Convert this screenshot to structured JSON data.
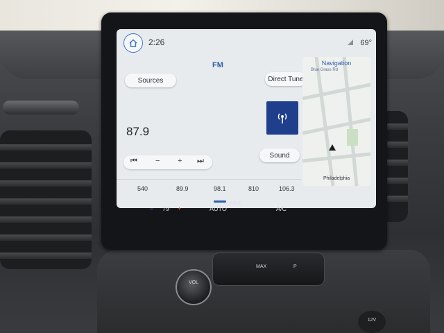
{
  "status": {
    "time": "2:26",
    "outside_temp": "69°"
  },
  "radio": {
    "band": "FM",
    "sources_label": "Sources",
    "direct_tune_label": "Direct Tune",
    "sound_label": "Sound",
    "frequency": "87.9",
    "controls": {
      "seek_back": "⏮",
      "tune_down": "−",
      "tune_up": "+",
      "seek_fwd": "⏭"
    },
    "presets": [
      "540",
      "89.9",
      "98.1",
      "810",
      "106.3"
    ]
  },
  "navigation": {
    "title": "Navigation",
    "road": "Blue Grass Rd",
    "city": "Philadelphia"
  },
  "climate": {
    "temp": "79°",
    "auto_label": "AUTO",
    "max_label": "MAX",
    "ac_label": "A/C"
  },
  "hardware": {
    "vol_label": "VOL",
    "max_label": "MAX",
    "park_label": "P",
    "usb_label": "12V"
  }
}
